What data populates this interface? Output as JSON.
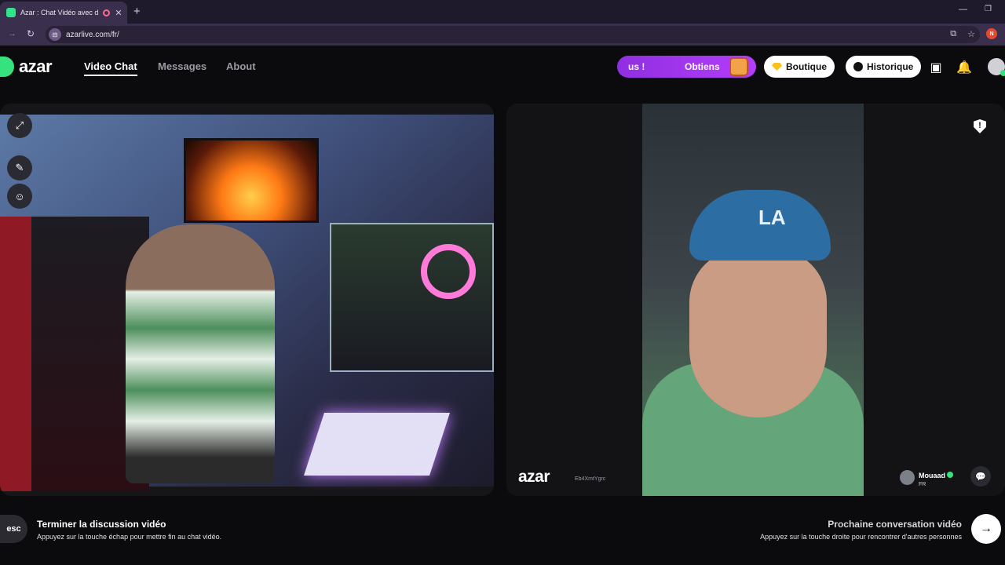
{
  "browser": {
    "tab_title": "Azar : Chat Vidéo avec de n",
    "tab_close": "✕",
    "new_tab": "+",
    "url": "azarlive.com/fr/",
    "profile_initial": "N"
  },
  "header": {
    "logo_text": "azar",
    "nav": [
      "Video Chat",
      "Messages",
      "About"
    ],
    "promo_left": "us !",
    "promo_right": "Obtiens",
    "shop_label": "Boutique",
    "history_label": "Historique"
  },
  "video": {
    "watermark": "azar",
    "watermark_id": "Eb4XmtYgrc",
    "peer_name": "Mouaad",
    "peer_country": "FR",
    "cap_logo": "LA"
  },
  "footer": {
    "esc_key": "esc",
    "end_title": "Terminer la discussion vidéo",
    "end_hint": "Appuyez sur la touche échap pour mettre fin au chat vidéo.",
    "next_title": "Prochaine conversation vidéo",
    "next_hint": "Appuyez sur la touche droite pour rencontrer d'autres personnes"
  },
  "colors": {
    "brand_green": "#35e27d",
    "promo_purple": "#9b34ec"
  }
}
